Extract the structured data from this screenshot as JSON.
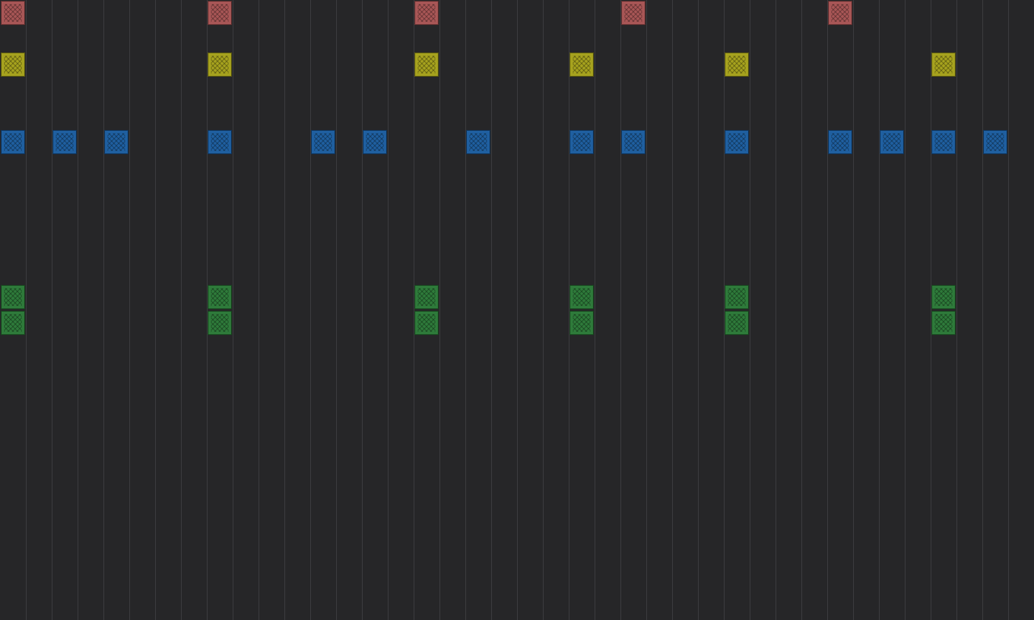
{
  "sequencer": {
    "steps": 40,
    "tracks": [
      {
        "id": "track-1",
        "color": "#a85656",
        "active_steps": [
          0,
          8,
          16,
          24,
          32
        ]
      },
      {
        "id": "track-2",
        "color": "#a6a21e",
        "active_steps": [
          0,
          8,
          16,
          22,
          28,
          36
        ]
      },
      {
        "id": "track-3",
        "color": "#1f5fa0",
        "active_steps": [
          0,
          2,
          4,
          8,
          12,
          14,
          18,
          22,
          24,
          28,
          32,
          34,
          36,
          38
        ]
      },
      {
        "id": "track-4",
        "color": "#2e7a3a",
        "active_steps": [
          0,
          8,
          16,
          22,
          28,
          36
        ]
      },
      {
        "id": "track-5",
        "color": "#2e7a3a",
        "active_steps": [
          0,
          8,
          16,
          22,
          28,
          36
        ]
      }
    ]
  }
}
